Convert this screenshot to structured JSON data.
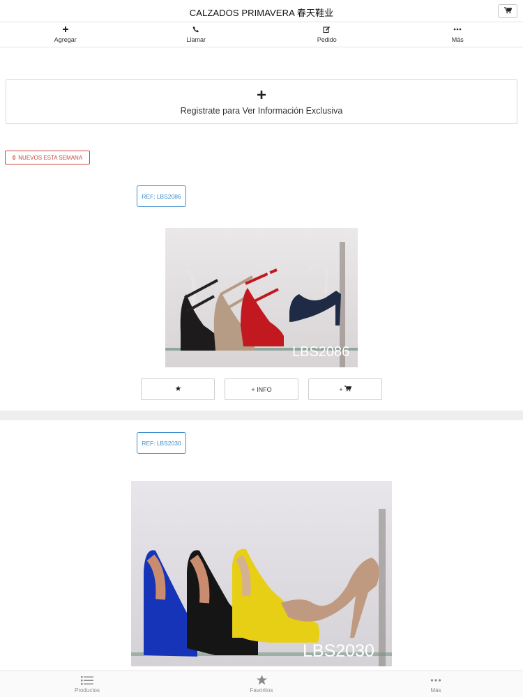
{
  "header": {
    "title": "CALZADOS PRIMAVERA 春天鞋业",
    "cart_icon": "cart-icon"
  },
  "actions": [
    {
      "label": "Agregar",
      "icon": "plus-icon"
    },
    {
      "label": "Llamar",
      "icon": "phone-icon"
    },
    {
      "label": "Pedido",
      "icon": "edit-icon"
    },
    {
      "label": "Más",
      "icon": "ellipsis-icon"
    }
  ],
  "register": {
    "icon": "plus-icon",
    "text": "Registrate para Ver Información Exclusiva"
  },
  "new_badge": {
    "count": "0",
    "label": "NUEVOS ESTA SEMANA",
    "color": "#c9463d"
  },
  "products": [
    {
      "ref_prefix": "REF:",
      "ref": "LBS2086",
      "image_caption": "LBS2086",
      "buttons": {
        "favorite_icon": "star-icon",
        "info": "+ INFO",
        "cart_prefix": "+",
        "cart_icon": "cart-icon"
      }
    },
    {
      "ref_prefix": "REF:",
      "ref": "LBS2030",
      "image_caption": "LBS2030"
    }
  ],
  "tabbar": [
    {
      "label": "Productos",
      "icon": "list-icon"
    },
    {
      "label": "Favoritos",
      "icon": "star-icon"
    },
    {
      "label": "Más",
      "icon": "ellipsis-icon"
    }
  ],
  "colors": {
    "accent_blue": "#3d8ed0",
    "badge_red": "#c9463d",
    "divider": "#eeeeee"
  }
}
